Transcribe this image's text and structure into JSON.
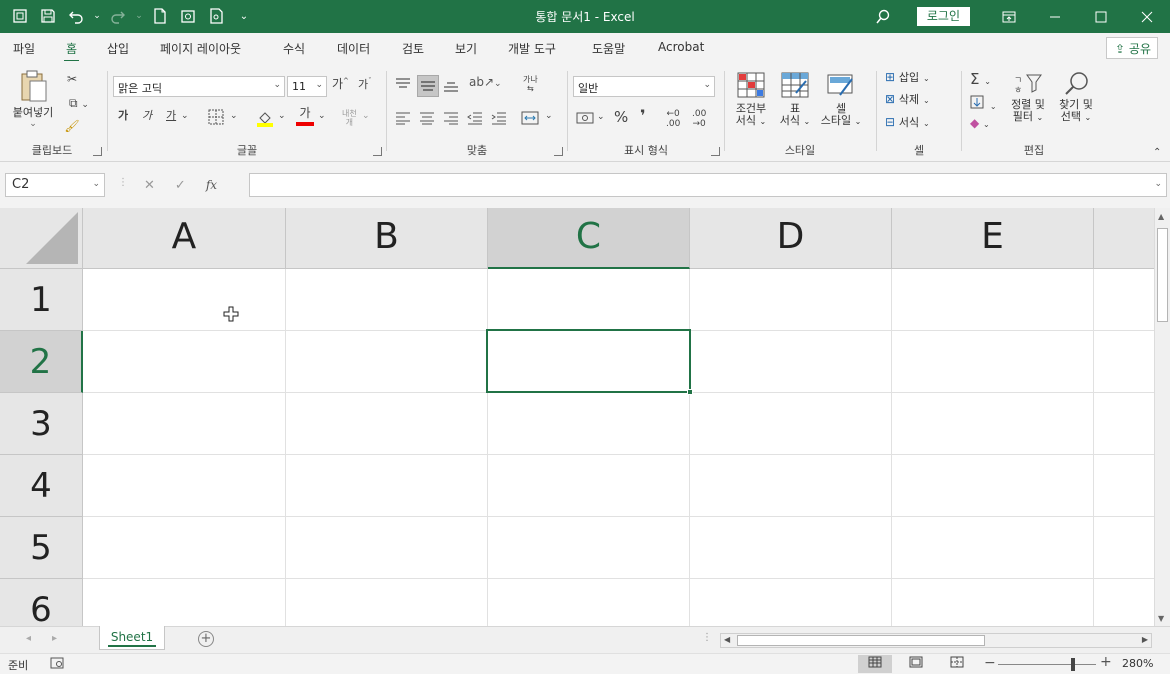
{
  "title_bar": {
    "document_title": "통합 문서1  -  Excel",
    "login_label": "로그인",
    "qat_icons": [
      "autosave-icon",
      "save-icon",
      "undo-icon",
      "redo-icon",
      "new-file-icon",
      "open-icon",
      "print-preview-icon",
      "customize-qat-icon"
    ]
  },
  "ribbon_tabs": [
    {
      "label": "파일",
      "active": false
    },
    {
      "label": "홈",
      "active": true
    },
    {
      "label": "삽입",
      "active": false
    },
    {
      "label": "페이지 레이아웃",
      "active": false
    },
    {
      "label": "수식",
      "active": false
    },
    {
      "label": "데이터",
      "active": false
    },
    {
      "label": "검토",
      "active": false
    },
    {
      "label": "보기",
      "active": false
    },
    {
      "label": "개발 도구",
      "active": false
    },
    {
      "label": "도움말",
      "active": false
    },
    {
      "label": "Acrobat",
      "active": false
    }
  ],
  "share_label": "공유",
  "ribbon": {
    "clipboard": {
      "label": "클립보드",
      "paste_label": "붙여넣기"
    },
    "font": {
      "label": "글꼴",
      "font_name": "맑은 고딕",
      "font_size": "11",
      "bold": "가",
      "italic": "가",
      "underline": "가",
      "font_color_glyph": "가",
      "grow": "가",
      "shrink": "가"
    },
    "alignment": {
      "label": "맞춤"
    },
    "number": {
      "label": "표시 형식",
      "format": "일반",
      "percent": "%",
      "comma": "❜"
    },
    "styles": {
      "label": "스타일",
      "conditional_line1": "조건부",
      "conditional_line2": "서식",
      "table_line1": "표",
      "table_line2": "서식",
      "cell_line1": "셀",
      "cell_line2": "스타일"
    },
    "cells": {
      "label": "셀",
      "insert": "삽입",
      "delete": "삭제",
      "format": "서식"
    },
    "editing": {
      "label": "편집",
      "sort_line1": "정렬 및",
      "sort_line2": "필터",
      "find_line1": "찾기 및",
      "find_line2": "선택"
    }
  },
  "formula_bar": {
    "name_box": "C2",
    "fx": "fx",
    "formula": ""
  },
  "columns": [
    {
      "label": "A",
      "selected": false
    },
    {
      "label": "B",
      "selected": false
    },
    {
      "label": "C",
      "selected": true
    },
    {
      "label": "D",
      "selected": false
    },
    {
      "label": "E",
      "selected": false
    }
  ],
  "rows": [
    {
      "label": "1",
      "selected": false
    },
    {
      "label": "2",
      "selected": true
    },
    {
      "label": "3",
      "selected": false
    },
    {
      "label": "4",
      "selected": false
    },
    {
      "label": "5",
      "selected": false
    },
    {
      "label": "6",
      "selected": false
    }
  ],
  "sheets": [
    {
      "label": "Sheet1",
      "active": true
    }
  ],
  "status": {
    "ready": "준비",
    "zoom": "280%"
  },
  "colors": {
    "accent": "#217346",
    "header_bg": "#e6e6e6",
    "selected_header_bg": "#d2d2d2",
    "gridline": "#e1e1e1"
  }
}
